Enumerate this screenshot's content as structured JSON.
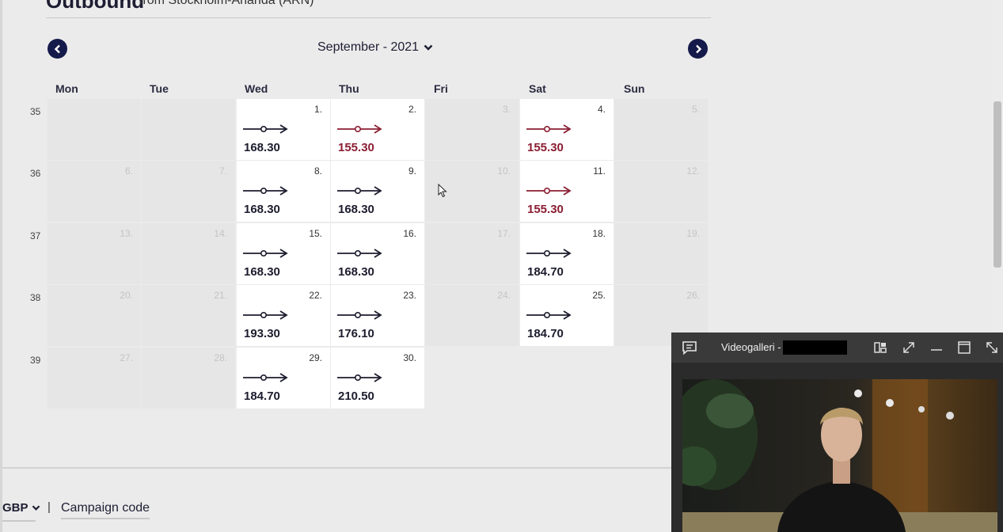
{
  "header": {
    "title": "Outbound",
    "subtitle": "from Stockholm-Arlanda (ARN)"
  },
  "calendar": {
    "month_label": "September - 2021",
    "weekdays": [
      "Mon",
      "Tue",
      "Wed",
      "Thu",
      "Fri",
      "Sat",
      "Sun"
    ],
    "weeks": [
      {
        "number": "35",
        "days": [
          {
            "day": "",
            "available": false
          },
          {
            "day": "",
            "available": false
          },
          {
            "day": "1.",
            "available": true,
            "price": "168.30",
            "cheapest": false
          },
          {
            "day": "2.",
            "available": true,
            "price": "155.30",
            "cheapest": true
          },
          {
            "day": "3.",
            "available": false
          },
          {
            "day": "4.",
            "available": true,
            "price": "155.30",
            "cheapest": true
          },
          {
            "day": "5.",
            "available": false
          }
        ]
      },
      {
        "number": "36",
        "days": [
          {
            "day": "6.",
            "available": false
          },
          {
            "day": "7.",
            "available": false
          },
          {
            "day": "8.",
            "available": true,
            "price": "168.30",
            "cheapest": false
          },
          {
            "day": "9.",
            "available": true,
            "price": "168.30",
            "cheapest": false
          },
          {
            "day": "10.",
            "available": false
          },
          {
            "day": "11.",
            "available": true,
            "price": "155.30",
            "cheapest": true
          },
          {
            "day": "12.",
            "available": false
          }
        ]
      },
      {
        "number": "37",
        "days": [
          {
            "day": "13.",
            "available": false
          },
          {
            "day": "14.",
            "available": false
          },
          {
            "day": "15.",
            "available": true,
            "price": "168.30",
            "cheapest": false
          },
          {
            "day": "16.",
            "available": true,
            "price": "168.30",
            "cheapest": false
          },
          {
            "day": "17.",
            "available": false
          },
          {
            "day": "18.",
            "available": true,
            "price": "184.70",
            "cheapest": false
          },
          {
            "day": "19.",
            "available": false
          }
        ]
      },
      {
        "number": "38",
        "days": [
          {
            "day": "20.",
            "available": false
          },
          {
            "day": "21.",
            "available": false
          },
          {
            "day": "22.",
            "available": true,
            "price": "193.30",
            "cheapest": false
          },
          {
            "day": "23.",
            "available": true,
            "price": "176.10",
            "cheapest": false
          },
          {
            "day": "24.",
            "available": false
          },
          {
            "day": "25.",
            "available": true,
            "price": "184.70",
            "cheapest": false
          },
          {
            "day": "26.",
            "available": false
          }
        ]
      },
      {
        "number": "39",
        "days": [
          {
            "day": "27.",
            "available": false
          },
          {
            "day": "28.",
            "available": false
          },
          {
            "day": "29.",
            "available": true,
            "price": "184.70",
            "cheapest": false
          },
          {
            "day": "30.",
            "available": true,
            "price": "210.50",
            "cheapest": false
          },
          null,
          null,
          null
        ]
      }
    ]
  },
  "footer": {
    "currency_label": "GBP",
    "separator": "|",
    "campaign_label": "Campaign code"
  },
  "video_window": {
    "title": "Videogalleri - "
  },
  "colors": {
    "regular_price": "#1c1c2e",
    "cheapest_price": "#8b1e32",
    "nav_button": "#141a4a"
  }
}
